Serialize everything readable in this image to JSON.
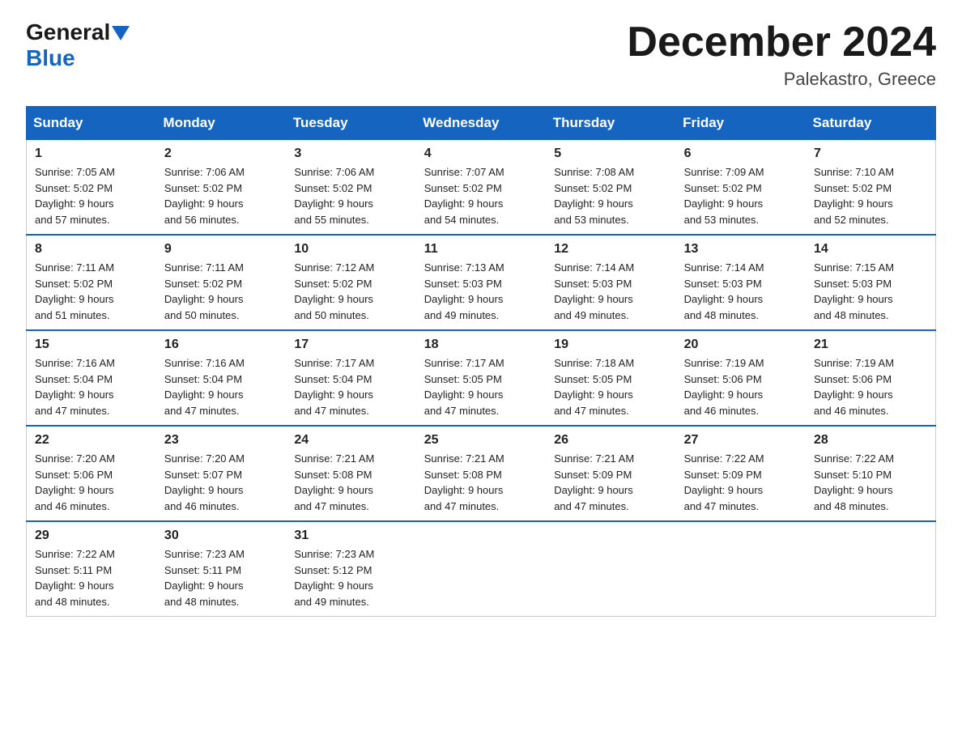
{
  "header": {
    "logo_general": "General",
    "logo_blue": "Blue",
    "month_title": "December 2024",
    "location": "Palekastro, Greece"
  },
  "columns": [
    "Sunday",
    "Monday",
    "Tuesday",
    "Wednesday",
    "Thursday",
    "Friday",
    "Saturday"
  ],
  "weeks": [
    [
      {
        "day": "1",
        "sunrise": "7:05 AM",
        "sunset": "5:02 PM",
        "daylight": "9 hours and 57 minutes."
      },
      {
        "day": "2",
        "sunrise": "7:06 AM",
        "sunset": "5:02 PM",
        "daylight": "9 hours and 56 minutes."
      },
      {
        "day": "3",
        "sunrise": "7:06 AM",
        "sunset": "5:02 PM",
        "daylight": "9 hours and 55 minutes."
      },
      {
        "day": "4",
        "sunrise": "7:07 AM",
        "sunset": "5:02 PM",
        "daylight": "9 hours and 54 minutes."
      },
      {
        "day": "5",
        "sunrise": "7:08 AM",
        "sunset": "5:02 PM",
        "daylight": "9 hours and 53 minutes."
      },
      {
        "day": "6",
        "sunrise": "7:09 AM",
        "sunset": "5:02 PM",
        "daylight": "9 hours and 53 minutes."
      },
      {
        "day": "7",
        "sunrise": "7:10 AM",
        "sunset": "5:02 PM",
        "daylight": "9 hours and 52 minutes."
      }
    ],
    [
      {
        "day": "8",
        "sunrise": "7:11 AM",
        "sunset": "5:02 PM",
        "daylight": "9 hours and 51 minutes."
      },
      {
        "day": "9",
        "sunrise": "7:11 AM",
        "sunset": "5:02 PM",
        "daylight": "9 hours and 50 minutes."
      },
      {
        "day": "10",
        "sunrise": "7:12 AM",
        "sunset": "5:02 PM",
        "daylight": "9 hours and 50 minutes."
      },
      {
        "day": "11",
        "sunrise": "7:13 AM",
        "sunset": "5:03 PM",
        "daylight": "9 hours and 49 minutes."
      },
      {
        "day": "12",
        "sunrise": "7:14 AM",
        "sunset": "5:03 PM",
        "daylight": "9 hours and 49 minutes."
      },
      {
        "day": "13",
        "sunrise": "7:14 AM",
        "sunset": "5:03 PM",
        "daylight": "9 hours and 48 minutes."
      },
      {
        "day": "14",
        "sunrise": "7:15 AM",
        "sunset": "5:03 PM",
        "daylight": "9 hours and 48 minutes."
      }
    ],
    [
      {
        "day": "15",
        "sunrise": "7:16 AM",
        "sunset": "5:04 PM",
        "daylight": "9 hours and 47 minutes."
      },
      {
        "day": "16",
        "sunrise": "7:16 AM",
        "sunset": "5:04 PM",
        "daylight": "9 hours and 47 minutes."
      },
      {
        "day": "17",
        "sunrise": "7:17 AM",
        "sunset": "5:04 PM",
        "daylight": "9 hours and 47 minutes."
      },
      {
        "day": "18",
        "sunrise": "7:17 AM",
        "sunset": "5:05 PM",
        "daylight": "9 hours and 47 minutes."
      },
      {
        "day": "19",
        "sunrise": "7:18 AM",
        "sunset": "5:05 PM",
        "daylight": "9 hours and 47 minutes."
      },
      {
        "day": "20",
        "sunrise": "7:19 AM",
        "sunset": "5:06 PM",
        "daylight": "9 hours and 46 minutes."
      },
      {
        "day": "21",
        "sunrise": "7:19 AM",
        "sunset": "5:06 PM",
        "daylight": "9 hours and 46 minutes."
      }
    ],
    [
      {
        "day": "22",
        "sunrise": "7:20 AM",
        "sunset": "5:06 PM",
        "daylight": "9 hours and 46 minutes."
      },
      {
        "day": "23",
        "sunrise": "7:20 AM",
        "sunset": "5:07 PM",
        "daylight": "9 hours and 46 minutes."
      },
      {
        "day": "24",
        "sunrise": "7:21 AM",
        "sunset": "5:08 PM",
        "daylight": "9 hours and 47 minutes."
      },
      {
        "day": "25",
        "sunrise": "7:21 AM",
        "sunset": "5:08 PM",
        "daylight": "9 hours and 47 minutes."
      },
      {
        "day": "26",
        "sunrise": "7:21 AM",
        "sunset": "5:09 PM",
        "daylight": "9 hours and 47 minutes."
      },
      {
        "day": "27",
        "sunrise": "7:22 AM",
        "sunset": "5:09 PM",
        "daylight": "9 hours and 47 minutes."
      },
      {
        "day": "28",
        "sunrise": "7:22 AM",
        "sunset": "5:10 PM",
        "daylight": "9 hours and 48 minutes."
      }
    ],
    [
      {
        "day": "29",
        "sunrise": "7:22 AM",
        "sunset": "5:11 PM",
        "daylight": "9 hours and 48 minutes."
      },
      {
        "day": "30",
        "sunrise": "7:23 AM",
        "sunset": "5:11 PM",
        "daylight": "9 hours and 48 minutes."
      },
      {
        "day": "31",
        "sunrise": "7:23 AM",
        "sunset": "5:12 PM",
        "daylight": "9 hours and 49 minutes."
      },
      null,
      null,
      null,
      null
    ]
  ],
  "labels": {
    "sunrise_prefix": "Sunrise: ",
    "sunset_prefix": "Sunset: ",
    "daylight_prefix": "Daylight: "
  }
}
